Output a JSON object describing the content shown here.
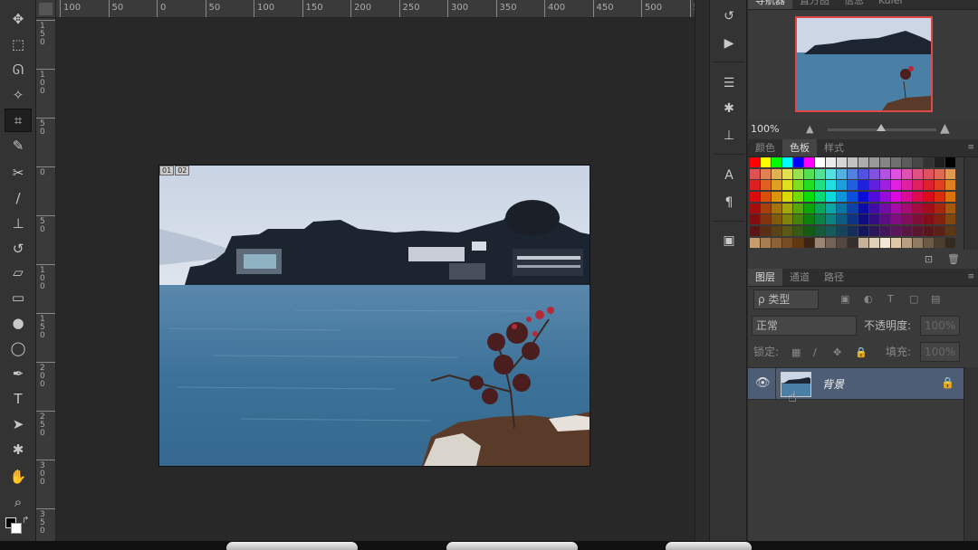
{
  "ruler": {
    "h_labels": [
      "100",
      "50",
      "0",
      "50",
      "100",
      "150",
      "200",
      "250",
      "300",
      "350",
      "400",
      "450",
      "500",
      "5"
    ],
    "v_labels": [
      "150",
      "100",
      "50",
      "0",
      "50",
      "100",
      "150",
      "200",
      "250",
      "300",
      "350"
    ]
  },
  "tools": [
    {
      "name": "move-tool-icon",
      "glyph": "✥"
    },
    {
      "name": "marquee-tool-icon",
      "glyph": "⬚"
    },
    {
      "name": "lasso-tool-icon",
      "glyph": "ᘏ"
    },
    {
      "name": "magic-wand-tool-icon",
      "glyph": "✧"
    },
    {
      "name": "crop-tool-icon",
      "glyph": "⌗"
    },
    {
      "name": "eyedropper-tool-icon",
      "glyph": "✎"
    },
    {
      "name": "healing-brush-tool-icon",
      "glyph": "✂"
    },
    {
      "name": "brush-tool-icon",
      "glyph": "∕"
    },
    {
      "name": "clone-stamp-tool-icon",
      "glyph": "⊥"
    },
    {
      "name": "history-brush-tool-icon",
      "glyph": "↺"
    },
    {
      "name": "eraser-tool-icon",
      "glyph": "▱"
    },
    {
      "name": "gradient-tool-icon",
      "glyph": "▭"
    },
    {
      "name": "blur-tool-icon",
      "glyph": "●"
    },
    {
      "name": "dodge-tool-icon",
      "glyph": "◯"
    },
    {
      "name": "pen-tool-icon",
      "glyph": "✒"
    },
    {
      "name": "type-tool-icon",
      "glyph": "T"
    },
    {
      "name": "path-selection-tool-icon",
      "glyph": "➤"
    },
    {
      "name": "shape-tool-icon",
      "glyph": "✱"
    },
    {
      "name": "hand-tool-icon",
      "glyph": "✋"
    },
    {
      "name": "zoom-tool-icon",
      "glyph": "⌕"
    }
  ],
  "photo_marks": [
    "01",
    "02"
  ],
  "navigator": {
    "tabs": [
      "导航器",
      "直方图",
      "信息",
      "Kuler"
    ],
    "zoom": "100%"
  },
  "swatches_panel": {
    "tabs": [
      "颜色",
      "色板",
      "样式"
    ]
  },
  "layers_panel": {
    "tabs": [
      "图层",
      "通道",
      "路径"
    ],
    "filter_kind": "ρ 类型",
    "blend_mode": "正常",
    "opacity_label": "不透明度:",
    "opacity_value": "100%",
    "lock_label": "锁定:",
    "fill_label": "填充:",
    "fill_value": "100%",
    "layer_name": "背景"
  },
  "colors": {
    "accent_red": "#e04848",
    "selected_layer": "#4d5d75",
    "panel_bg": "#3a3a3a"
  }
}
